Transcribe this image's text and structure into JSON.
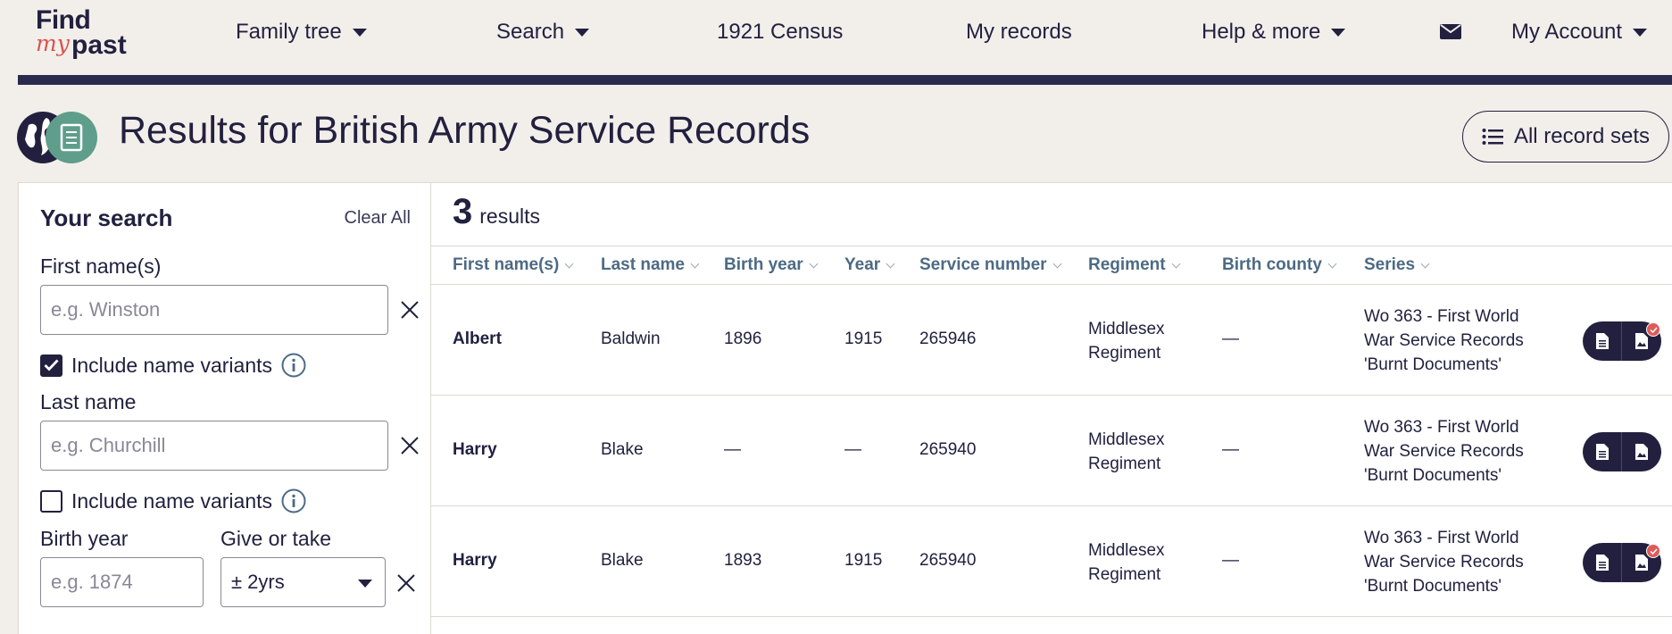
{
  "nav": {
    "logo": {
      "line1": "Find",
      "line2": "my",
      "line3": "past"
    },
    "items": [
      {
        "label": "Family tree",
        "dropdown": true
      },
      {
        "label": "Search",
        "dropdown": true
      },
      {
        "label": "1921 Census",
        "dropdown": false
      },
      {
        "label": "My records",
        "dropdown": false
      },
      {
        "label": "Help & more",
        "dropdown": true
      },
      {
        "label": "My Account",
        "dropdown": true
      }
    ],
    "mail_icon": "envelope-icon"
  },
  "header": {
    "title": "Results for British Army Service Records",
    "all_record_sets_label": "All record sets"
  },
  "sidebar": {
    "title": "Your search",
    "clear_all": "Clear All",
    "first_name_label": "First name(s)",
    "first_name_placeholder": "e.g. Winston",
    "first_name_variants_label": "Include name variants",
    "first_name_variants_checked": true,
    "last_name_label": "Last name",
    "last_name_placeholder": "e.g. Churchill",
    "last_name_variants_label": "Include name variants",
    "last_name_variants_checked": false,
    "birth_year_label": "Birth year",
    "birth_year_placeholder": "e.g. 1874",
    "give_or_take_label": "Give or take",
    "give_or_take_value": "± 2yrs"
  },
  "results": {
    "count": "3",
    "count_label": "results",
    "columns": [
      "First name(s)",
      "Last name",
      "Birth year",
      "Year",
      "Service number",
      "Regiment",
      "Birth county",
      "Series"
    ],
    "rows": [
      {
        "first_name": "Albert",
        "last_name": "Baldwin",
        "birth_year": "1896",
        "year": "1915",
        "service_number": "265946",
        "regiment": "Middlesex Regiment",
        "birth_county": "—",
        "series": "Wo 363 - First World War Service Records 'Burnt Documents'",
        "has_badge": true
      },
      {
        "first_name": "Harry",
        "last_name": "Blake",
        "birth_year": "—",
        "year": "—",
        "service_number": "265940",
        "regiment": "Middlesex Regiment",
        "birth_county": "—",
        "series": "Wo 363 - First World War Service Records 'Burnt Documents'",
        "has_badge": false
      },
      {
        "first_name": "Harry",
        "last_name": "Blake",
        "birth_year": "1893",
        "year": "1915",
        "service_number": "265940",
        "regiment": "Middlesex Regiment",
        "birth_county": "—",
        "series": "Wo 363 - First World War Service Records 'Burnt Documents'",
        "has_badge": true
      }
    ]
  },
  "colors": {
    "navy": "#23203f",
    "background": "#f2efeb",
    "header_text": "#4d6a84",
    "accent_red": "#d9534f",
    "globe_green": "#5f9e8a"
  }
}
